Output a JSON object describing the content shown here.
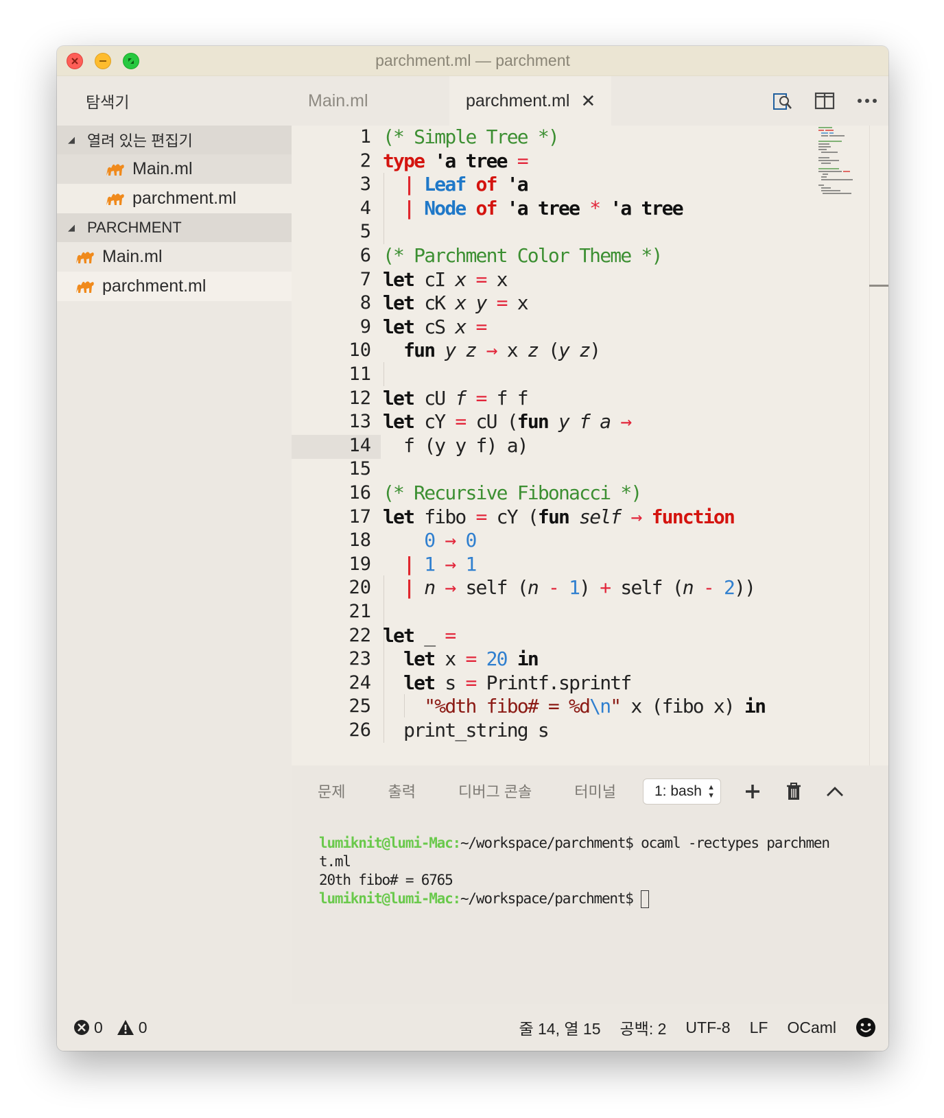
{
  "window": {
    "title": "parchment.ml — parchment"
  },
  "sidebar": {
    "header": "탐색기",
    "open_editors": {
      "label": "열려 있는 편집기",
      "files": [
        "Main.ml",
        "parchment.ml"
      ]
    },
    "project": {
      "label": "PARCHMENT",
      "files": [
        "Main.ml",
        "parchment.ml"
      ]
    }
  },
  "tabs": [
    {
      "label": "Main.ml",
      "active": false
    },
    {
      "label": "parchment.ml",
      "active": true,
      "close": "✕"
    }
  ],
  "tab_actions": [
    "open-preview-icon",
    "split-editor-icon",
    "more-actions-icon"
  ],
  "editor": {
    "cursor_line": 14,
    "line_numbers": [
      "1",
      "2",
      "3",
      "4",
      "5",
      "6",
      "7",
      "8",
      "9",
      "10",
      "11",
      "12",
      "13",
      "14",
      "15",
      "16",
      "17",
      "18",
      "19",
      "20",
      "21",
      "22",
      "23",
      "24",
      "25",
      "26"
    ],
    "lines": [
      "(* Simple Tree *)",
      "type 'a tree =",
      "  | Leaf of 'a",
      "  | Node of 'a tree * 'a tree",
      "",
      "(* Parchment Color Theme *)",
      "let cI x = x",
      "let cK x y = x",
      "let cS x =",
      "  fun y z -> x z (y z)",
      "",
      "let cU f = f f",
      "let cY = cU (fun y f a ->",
      "  f (y y f) a)",
      "",
      "(* Recursive Fibonacci *)",
      "let fibo = cY (fun self -> function",
      "    0 -> 0",
      "  | 1 -> 1",
      "  | n -> self (n - 1) + self (n - 2))",
      "",
      "let _ =",
      "  let x = 20 in",
      "  let s = Printf.sprintf",
      "    \"%dth fibo# = %d\\n\" x (fibo x) in",
      "  print_string s"
    ]
  },
  "panel": {
    "tabs": [
      "문제",
      "출력",
      "디버그 콘솔",
      "터미널"
    ],
    "terminal_select": "1: bash",
    "terminal": {
      "user": "lumiknit@lumi-Mac:",
      "line1_rest": "~/workspace/parchment$ ocaml -rectypes parchmen",
      "line2": "t.ml",
      "line3": "20th fibo# = 6765",
      "line4_rest": "~/workspace/parchment$ "
    }
  },
  "status": {
    "errors": "0",
    "warnings": "0",
    "position": "줄 14, 열 15",
    "spaces": "공백: 2",
    "encoding": "UTF-8",
    "eol": "LF",
    "language": "OCaml"
  },
  "colors": {
    "keyword": "#d4140f",
    "comment": "#3c8f32",
    "constructor": "#1f78c8",
    "number": "#2f7fcf",
    "terminal_user": "#6ac94c"
  }
}
